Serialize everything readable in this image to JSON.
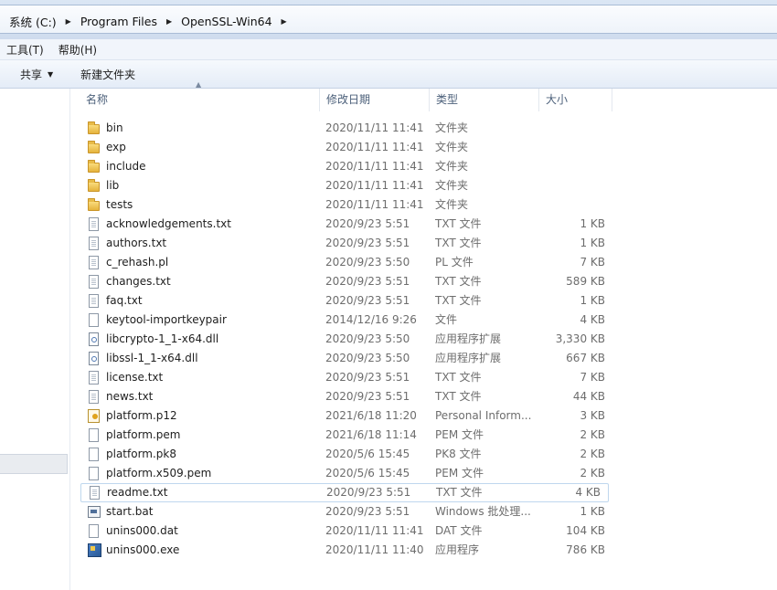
{
  "breadcrumb": [
    "系统 (C:)",
    "Program Files",
    "OpenSSL-Win64"
  ],
  "menu": [
    "工具(T)",
    "帮助(H)"
  ],
  "commands": {
    "share": "共享",
    "new_folder": "新建文件夹"
  },
  "columns": {
    "name": "名称",
    "date": "修改日期",
    "type": "类型",
    "size": "大小"
  },
  "files": [
    {
      "name": "bin",
      "date": "2020/11/11 11:41",
      "type": "文件夹",
      "size": "",
      "icon": "folder-icon"
    },
    {
      "name": "exp",
      "date": "2020/11/11 11:41",
      "type": "文件夹",
      "size": "",
      "icon": "folder-icon"
    },
    {
      "name": "include",
      "date": "2020/11/11 11:41",
      "type": "文件夹",
      "size": "",
      "icon": "folder-icon"
    },
    {
      "name": "lib",
      "date": "2020/11/11 11:41",
      "type": "文件夹",
      "size": "",
      "icon": "folder-icon"
    },
    {
      "name": "tests",
      "date": "2020/11/11 11:41",
      "type": "文件夹",
      "size": "",
      "icon": "folder-icon"
    },
    {
      "name": "acknowledgements.txt",
      "date": "2020/9/23 5:51",
      "type": "TXT 文件",
      "size": "1 KB",
      "icon": "text-file-icon"
    },
    {
      "name": "authors.txt",
      "date": "2020/9/23 5:51",
      "type": "TXT 文件",
      "size": "1 KB",
      "icon": "text-file-icon"
    },
    {
      "name": "c_rehash.pl",
      "date": "2020/9/23 5:50",
      "type": "PL 文件",
      "size": "7 KB",
      "icon": "text-file-icon"
    },
    {
      "name": "changes.txt",
      "date": "2020/9/23 5:51",
      "type": "TXT 文件",
      "size": "589 KB",
      "icon": "text-file-icon"
    },
    {
      "name": "faq.txt",
      "date": "2020/9/23 5:51",
      "type": "TXT 文件",
      "size": "1 KB",
      "icon": "text-file-icon"
    },
    {
      "name": "keytool-importkeypair",
      "date": "2014/12/16 9:26",
      "type": "文件",
      "size": "4 KB",
      "icon": "blank-file-icon"
    },
    {
      "name": "libcrypto-1_1-x64.dll",
      "date": "2020/9/23 5:50",
      "type": "应用程序扩展",
      "size": "3,330 KB",
      "icon": "dll-file-icon"
    },
    {
      "name": "libssl-1_1-x64.dll",
      "date": "2020/9/23 5:50",
      "type": "应用程序扩展",
      "size": "667 KB",
      "icon": "dll-file-icon"
    },
    {
      "name": "license.txt",
      "date": "2020/9/23 5:51",
      "type": "TXT 文件",
      "size": "7 KB",
      "icon": "text-file-icon"
    },
    {
      "name": "news.txt",
      "date": "2020/9/23 5:51",
      "type": "TXT 文件",
      "size": "44 KB",
      "icon": "text-file-icon"
    },
    {
      "name": "platform.p12",
      "date": "2021/6/18 11:20",
      "type": "Personal Inform...",
      "size": "3 KB",
      "icon": "certificate-icon"
    },
    {
      "name": "platform.pem",
      "date": "2021/6/18 11:14",
      "type": "PEM 文件",
      "size": "2 KB",
      "icon": "blank-file-icon"
    },
    {
      "name": "platform.pk8",
      "date": "2020/5/6 15:45",
      "type": "PK8 文件",
      "size": "2 KB",
      "icon": "blank-file-icon"
    },
    {
      "name": "platform.x509.pem",
      "date": "2020/5/6 15:45",
      "type": "PEM 文件",
      "size": "2 KB",
      "icon": "blank-file-icon"
    },
    {
      "name": "readme.txt",
      "date": "2020/9/23 5:51",
      "type": "TXT 文件",
      "size": "4 KB",
      "icon": "text-file-icon",
      "selected": true
    },
    {
      "name": "start.bat",
      "date": "2020/9/23 5:51",
      "type": "Windows 批处理...",
      "size": "1 KB",
      "icon": "batch-file-icon"
    },
    {
      "name": "unins000.dat",
      "date": "2020/11/11 11:41",
      "type": "DAT 文件",
      "size": "104 KB",
      "icon": "blank-file-icon"
    },
    {
      "name": "unins000.exe",
      "date": "2020/11/11 11:40",
      "type": "应用程序",
      "size": "786 KB",
      "icon": "application-icon"
    }
  ]
}
